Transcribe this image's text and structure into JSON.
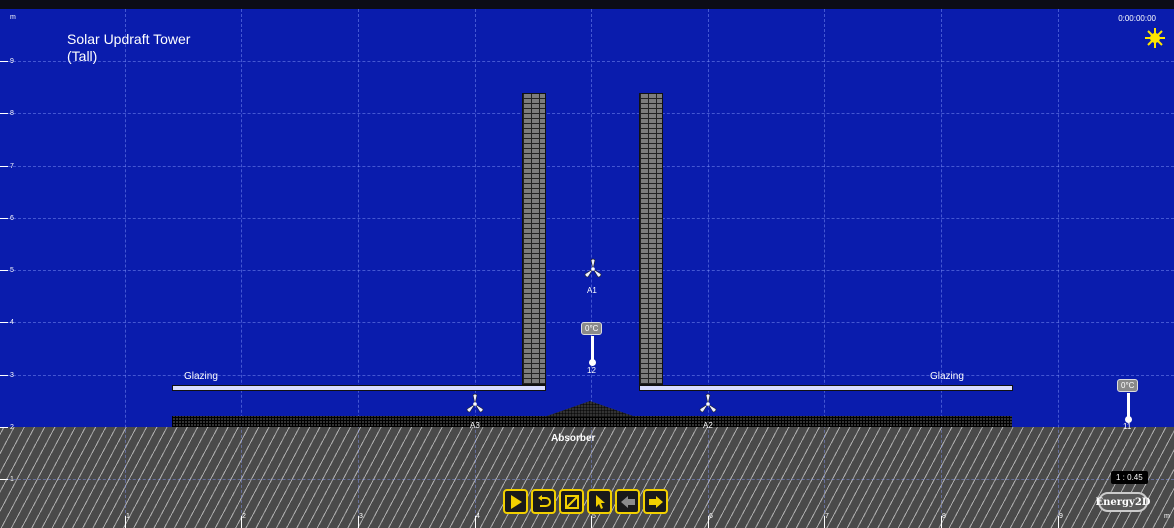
{
  "title": {
    "line1": "Solar Updraft Tower",
    "line2": "(Tall)"
  },
  "timer": "0:00:00:00",
  "unit_label": "m",
  "y_axis_labels": [
    "9",
    "8",
    "7",
    "6",
    "5",
    "4",
    "3",
    "2",
    "1"
  ],
  "x_axis_labels": [
    "1",
    "2",
    "3",
    "4",
    "5",
    "6",
    "7",
    "8",
    "9",
    "m"
  ],
  "glazing_left_label": "Glazing",
  "glazing_right_label": "Glazing",
  "absorber_label": "Absorber",
  "fans": {
    "a1": "A1",
    "a2": "A2",
    "a3": "A3"
  },
  "thermometers": {
    "t12": {
      "reading": "0°C",
      "label": "12"
    },
    "t11": {
      "reading": "0°C",
      "label": "11"
    }
  },
  "scale": "1 : 0.45",
  "logo": "Energy2D",
  "toolbar": [
    "play-icon",
    "reset-icon",
    "clear-icon",
    "select-icon",
    "undo-icon",
    "redo-icon"
  ],
  "colors": {
    "sky": "#0a1cad",
    "accent": "#f2d000",
    "ground": "#4a4a4a"
  }
}
